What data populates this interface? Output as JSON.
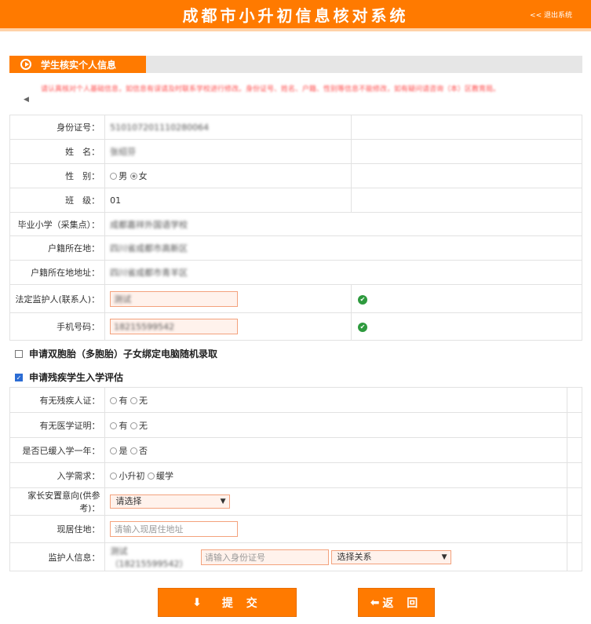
{
  "header": {
    "title": "成都市小升初信息核对系统",
    "logout": "<< 退出系统"
  },
  "section": {
    "title": "学生核实个人信息"
  },
  "notice": {
    "text": "请认真核对个人基础信息，如信息有误请及时联系学校进行修改。身份证号、姓名、户籍、性别等信息不能修改，如有疑问请咨询（本）区教育局。"
  },
  "info": {
    "id_label": "身份证号：",
    "id_value": "510107201110280064",
    "name_label": "姓　名：",
    "name_value": "张绍芬",
    "gender_label": "性　别：",
    "gender_male": "男",
    "gender_female": "女",
    "class_label": "班　级：",
    "class_value": "01",
    "school_label": "毕业小学（采集点）：",
    "school_value": "成都嘉祥外国语学校",
    "hukou_label": "户籍所在地：",
    "hukou_value": "四川省成都市高新区",
    "hukou_addr_label": "户籍所在地地址：",
    "hukou_addr_value": "四川省成都市青羊区",
    "guardian_label": "法定监护人(联系人)：",
    "guardian_value": "测试",
    "phone_label": "手机号码：",
    "phone_value": "18215599542"
  },
  "options": {
    "twins_label": "申请双胞胎（多胞胎）子女绑定电脑随机录取",
    "disabled_label": "申请残疾学生入学评估"
  },
  "assessment": {
    "cert_label": "有无残疾人证：",
    "yes": "有",
    "no": "无",
    "medical_label": "有无医学证明：",
    "delay_label": "是否已缓入学一年：",
    "is": "是",
    "isnot": "否",
    "need_label": "入学需求：",
    "need_a": "小升初",
    "need_b": "缓学",
    "intent_label": "家长安置意向(供参考)：",
    "intent_select": "请选择",
    "address_label": "现居住地：",
    "address_placeholder": "请输入现居住地址",
    "guardian_label": "监护人信息：",
    "guardian_value": "测试（18215599542）",
    "idcard_placeholder": "请输入身份证号",
    "relation_select": "选择关系"
  },
  "buttons": {
    "submit": "提 交",
    "back": "返 回"
  },
  "colors": {
    "brand": "#ff7a00",
    "success": "#2e9a3e"
  }
}
